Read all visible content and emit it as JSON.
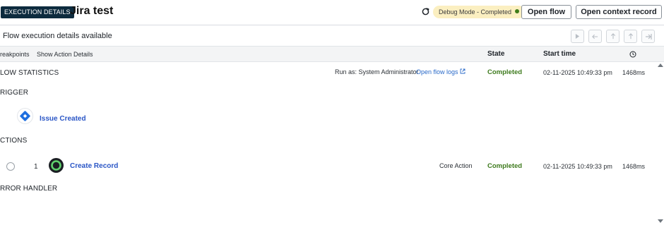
{
  "header": {
    "badge": "EXECUTION DETAILS",
    "title": "Jira test",
    "debug_status": "Debug Mode - Completed",
    "open_flow_label": "Open flow",
    "open_context_label": "Open context record"
  },
  "subheader": {
    "text": "Flow execution details available",
    "nav_buttons": [
      "play-icon",
      "step-back-icon",
      "step-in-icon",
      "step-out-icon",
      "skip-to-end-icon"
    ]
  },
  "columns": {
    "breakpoints": "reakpoints",
    "show_action_details": "Show Action Details",
    "state": "State",
    "start_time": "Start time",
    "duration_icon": "clock-icon"
  },
  "flow_statistics": {
    "label": "LOW STATISTICS",
    "run_as": "Run as: System Administrator",
    "flow_logs_link": "Open flow logs",
    "state": "Completed",
    "start_time": "02-11-2025 10:49:33 pm",
    "duration": "1468ms"
  },
  "trigger": {
    "section_label": "RIGGER",
    "name": "Issue Created",
    "icon": "jira-diamond-icon"
  },
  "actions": {
    "section_label": "CTIONS",
    "items": [
      {
        "number": "1",
        "name": "Create Record",
        "icon": "servicenow-action-icon",
        "type": "Core Action",
        "state": "Completed",
        "start_time": "02-11-2025 10:49:33 pm",
        "duration": "1468ms"
      }
    ]
  },
  "error_handler": {
    "section_label": "RROR HANDLER"
  },
  "colors": {
    "badge_bg": "#0d2b3e",
    "debug_pill_bg": "#fbefc1",
    "completed_green": "#3d7a1c",
    "link_blue": "#2a56c6"
  }
}
